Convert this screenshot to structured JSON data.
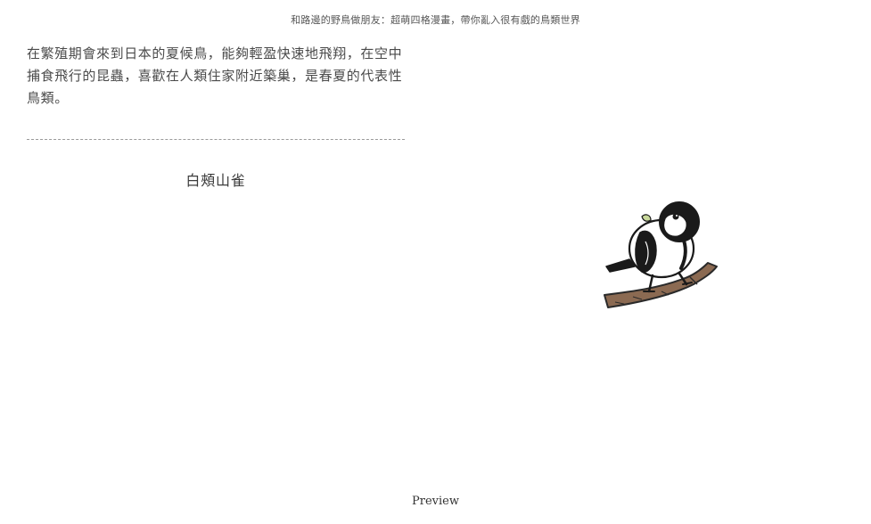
{
  "header": {
    "book_title": "和路邊的野鳥做朋友：超萌四格漫畫，帶你亂入很有戲的鳥類世界"
  },
  "content": {
    "paragraph": "在繁殖期會來到日本的夏候鳥，能夠輕盈快速地飛翔，在空中捕食飛行的昆蟲，喜歡在人類住家附近築巢，是春夏的代表性鳥類。",
    "bird_name": "白頰山雀",
    "illustration": {
      "icon": "bird-on-branch-illustration",
      "colors": {
        "branch": "#8b6a52",
        "bird_black": "#1a1a1a",
        "bird_white": "#ffffff",
        "wing_accent": "#c8d89a"
      }
    }
  },
  "footer": {
    "preview_label": "Preview"
  }
}
